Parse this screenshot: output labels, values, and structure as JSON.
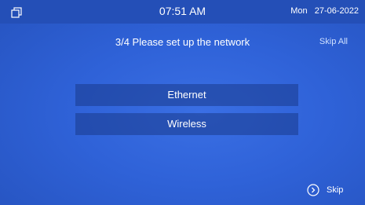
{
  "status_bar": {
    "window_icon": "restore-window-icon",
    "time": "07:51 AM",
    "day": "Mon",
    "date": "27-06-2022"
  },
  "setup": {
    "title": "3/4 Please set up the network",
    "skip_all_label": "Skip All",
    "options": [
      {
        "label": "Ethernet"
      },
      {
        "label": "Wireless"
      }
    ],
    "skip_label": "Skip",
    "skip_icon": "chevron-right-circle-icon"
  },
  "colors": {
    "background": "#2f62d8",
    "status_bar": "#244fb7",
    "option_background": "#1a3a8c",
    "text": "#ffffff"
  }
}
